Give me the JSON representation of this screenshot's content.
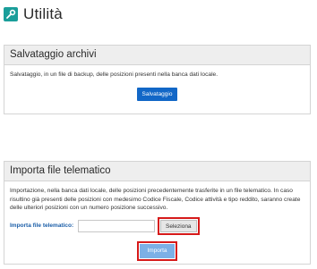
{
  "page": {
    "title": "Utilità",
    "icon": "wrench-icon",
    "accent": "#1a9e9a"
  },
  "backup": {
    "header": "Salvataggio archivi",
    "description": "Salvataggio, in un file di backup, delle posizioni presenti nella banca dati locale.",
    "button_label": "Salvataggio"
  },
  "import": {
    "header": "Importa file telematico",
    "description": "Importazione, nella banca dati locale, delle posizioni precedentemente trasferite in un file telematico. In caso risultino già presenti delle posizioni con medesimo Codice Fiscale, Codice attività e tipo reddito, saranno create delle ulteriori posizioni con un numero posizione successivo.",
    "file_label": "Importa file telematico:",
    "file_value": "",
    "select_button_label": "Seleziona",
    "import_button_label": "Importa"
  },
  "colors": {
    "primary_button": "#1267c7",
    "disabled_button": "#7cb0e6",
    "highlight": "#d61a1a"
  }
}
